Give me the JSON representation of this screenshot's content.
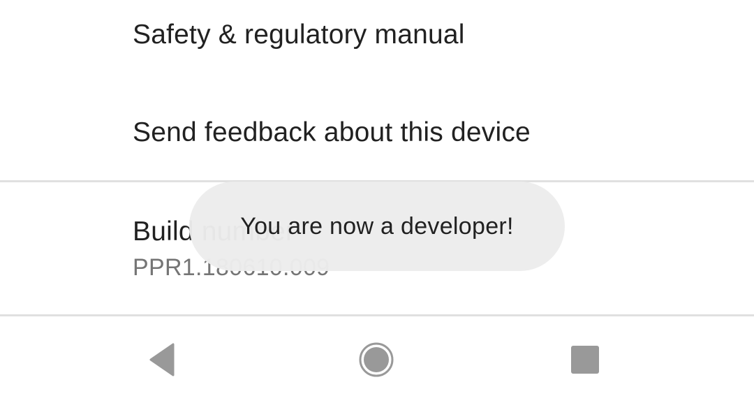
{
  "settings": {
    "items": [
      {
        "title": "Safety & regulatory manual"
      },
      {
        "title": "Send feedback about this device"
      },
      {
        "title": "Build number",
        "summary": "PPR1.180610.009"
      }
    ]
  },
  "toast": {
    "message": "You are now a developer!"
  },
  "navigation_bar": {
    "buttons": [
      {
        "icon": "back-icon"
      },
      {
        "icon": "home-icon"
      },
      {
        "icon": "recents-icon"
      }
    ]
  },
  "colors": {
    "title_text": "#212121",
    "summary_text": "#757575",
    "divider": "#e0e0e0",
    "toast_background": "#ececec",
    "nav_icon": "#999999"
  }
}
